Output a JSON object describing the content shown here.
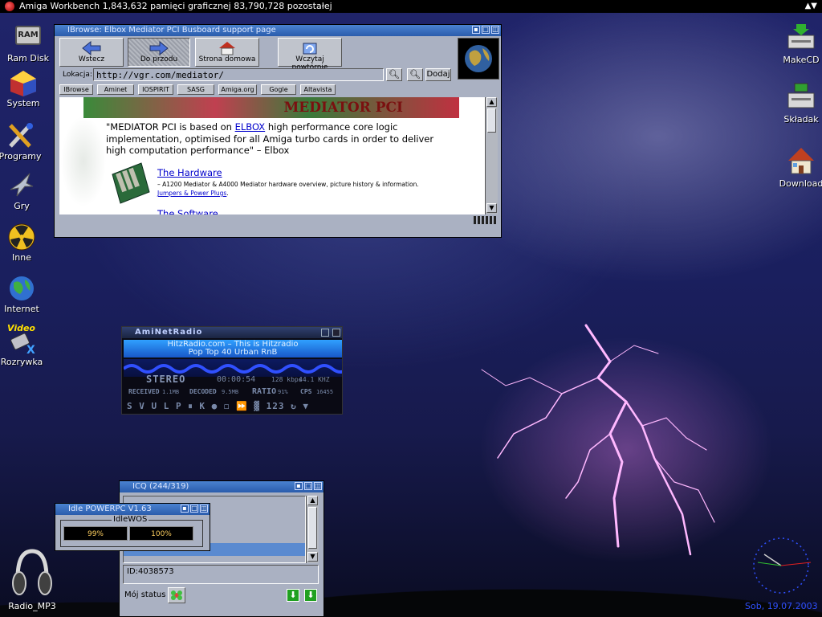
{
  "topbar": {
    "title": "Amiga Workbench    1,843,632 pamięci graficznej  83,790,728 pozostałej",
    "right_glyph": "▲▼"
  },
  "desktop": {
    "left_icons": [
      {
        "label": "Ram Disk",
        "icon": "ram-disk-icon",
        "badge": "RAM"
      },
      {
        "label": "System",
        "icon": "system-icon"
      },
      {
        "label": "Programy",
        "icon": "tools-icon"
      },
      {
        "label": "Gry",
        "icon": "jet-icon"
      },
      {
        "label": "Inne",
        "icon": "radiation-icon"
      },
      {
        "label": "Internet",
        "icon": "globe-icon"
      },
      {
        "label": "Rozrywka",
        "icon": "video-icon",
        "badge": "Video"
      },
      {
        "label": "Radio_MP3",
        "icon": "headphones-icon"
      }
    ],
    "right_icons": [
      {
        "label": "MakeCD",
        "icon": "cd-drive-icon"
      },
      {
        "label": "Składak",
        "icon": "drive-icon"
      },
      {
        "label": "Download",
        "icon": "house-icon"
      }
    ],
    "clock_date": "Sob, 19.07.2003"
  },
  "browser": {
    "title": "IBrowse: Elbox Mediator PCI Busboard support page",
    "buttons": {
      "back": "Wstecz",
      "forward": "Do przodu",
      "home": "Strona domowa",
      "reload": "Wczytaj powtórnie"
    },
    "location_label": "Lokacja:",
    "url": "http://vgr.com/mediator/",
    "add_button": "Dodaj",
    "hotlist": [
      "IBrowse",
      "Aminet",
      "IOSPIRIT",
      "SASG",
      "Amiga.org",
      "Gogle",
      "Altavista"
    ],
    "page": {
      "banner": "MEDIATOR PCI",
      "quote_before": "\"MEDIATOR PCI is based on ",
      "quote_link": "ELBOX",
      "quote_after": " high performance core logic implementation, optimised for all Amiga turbo cards in order to deliver high computation performance\" – Elbox",
      "hardware_link": "The Hardware",
      "hardware_desc": "– A1200 Mediator & A4000 Mediator hardware overview, picture history & information.",
      "jumpers_link": "Jumpers & Power Plugs",
      "jumpers_suffix": ".",
      "next_link": "The Software"
    }
  },
  "radio": {
    "title": "AmiNetRadio",
    "line1": "HitzRadio.com – This is Hitzradio",
    "line2": "Pop Top 40 Urban RnB",
    "stereo": "STEREO",
    "time": "00:00:54",
    "kbps": "128 kbps",
    "khz": "44.1 KHZ",
    "received_label": "RECEIVED",
    "received": "1.1MB",
    "decoded_label": "DECODED",
    "decoded": "9.5MB",
    "ratio_label": "RATIO",
    "ratio": "91%",
    "cps_label": "CPS",
    "cps": "16455",
    "controls": "S V U L P ⏸  K ● ◻ ⏩  ▓ 123 ↻ ▼"
  },
  "icq": {
    "title": "ICQ (244/319)",
    "id": "ID:4038573",
    "status_label": "Mój status"
  },
  "idle": {
    "title": "Idle POWERPC V1.63",
    "group": "IdleWOS",
    "value1": "99%",
    "value2": "100%"
  },
  "colors": {
    "accent": "#2a5cac",
    "link": "#0000cc",
    "window_bg": "#aab1c2"
  }
}
